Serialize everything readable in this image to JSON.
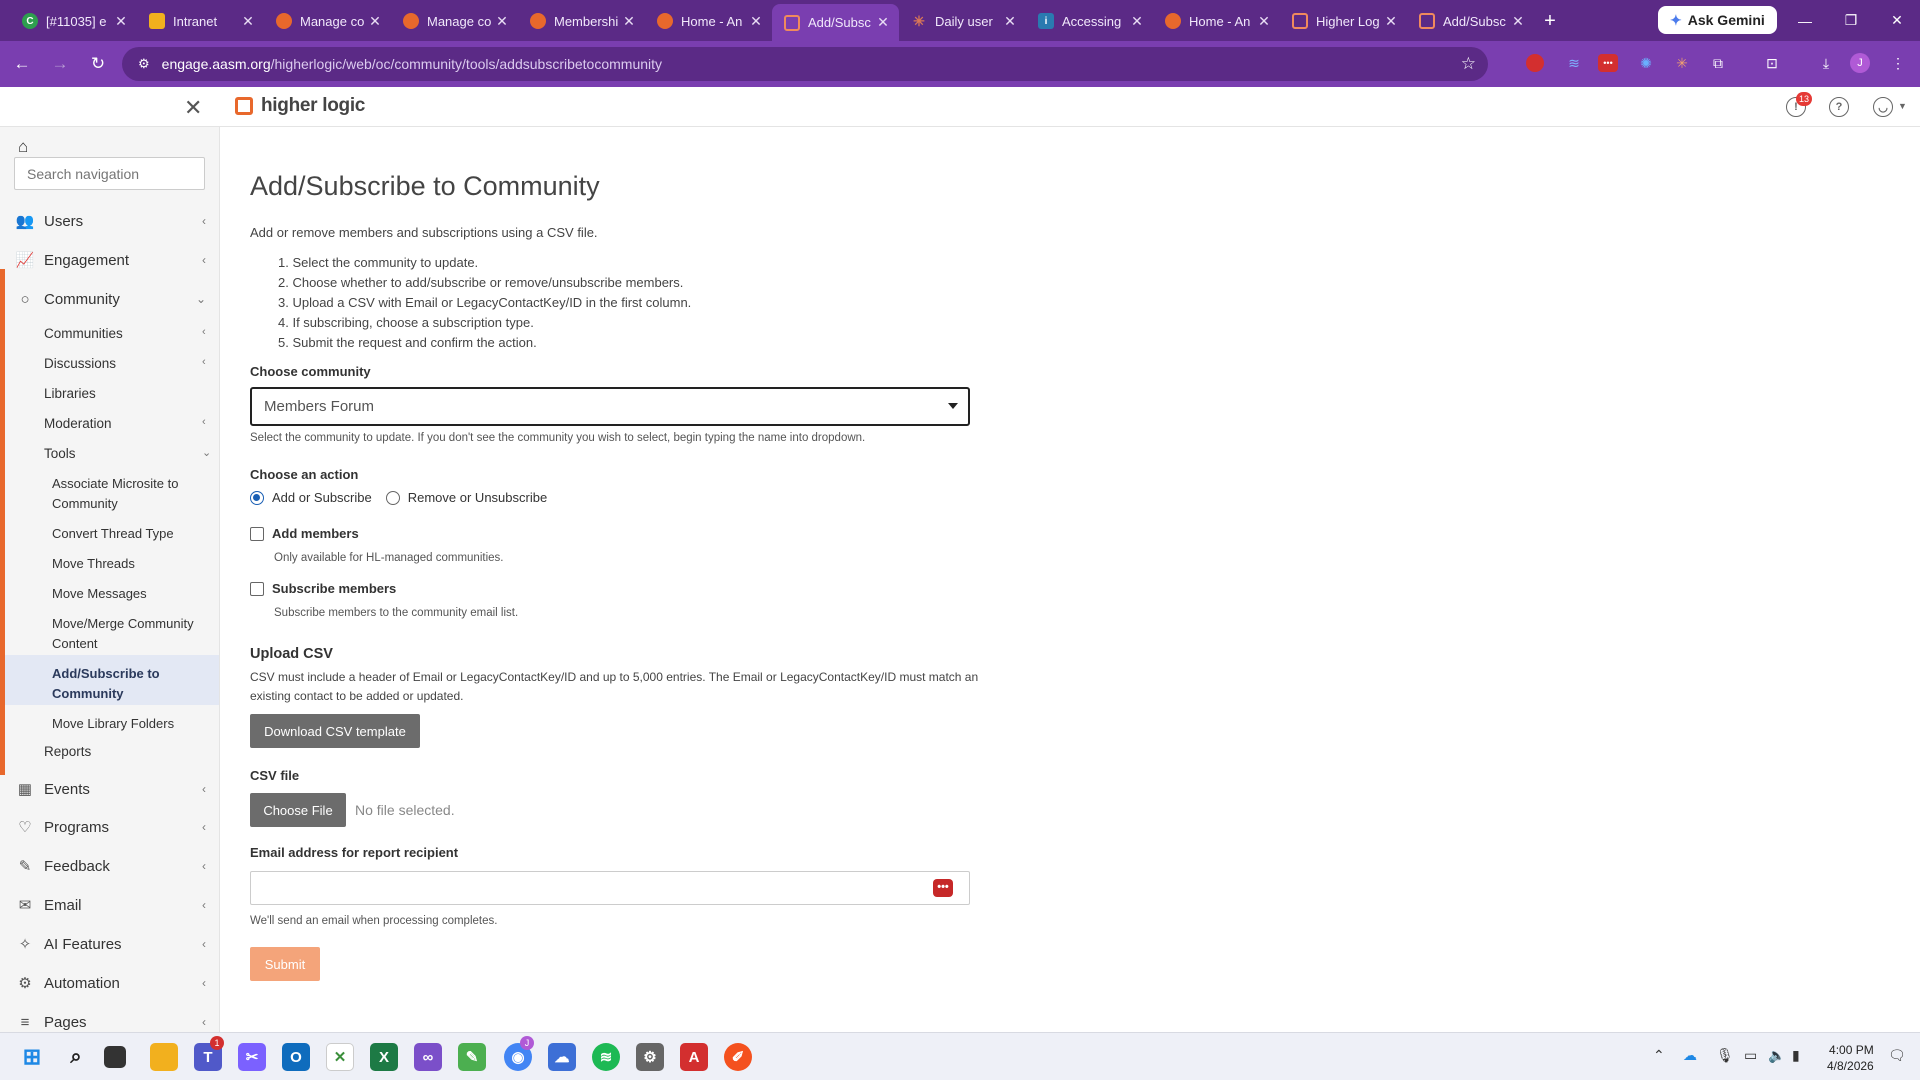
{
  "browser": {
    "tabs": [
      {
        "title": "[#11035] e",
        "icon": "green-circle-icon",
        "color": "#2e9e4f"
      },
      {
        "title": "Intranet",
        "icon": "yellow-doc-icon",
        "color": "#f2b01e"
      },
      {
        "title": "Manage co",
        "icon": "mini-logo-icon",
        "color": "#e8682c"
      },
      {
        "title": "Manage co",
        "icon": "mini-logo-icon",
        "color": "#e8682c"
      },
      {
        "title": "Membershi",
        "icon": "mini-logo-icon",
        "color": "#e8682c"
      },
      {
        "title": "Home - An",
        "icon": "mini-logo-icon",
        "color": "#e8682c"
      },
      {
        "title": "Add/Subsc",
        "icon": "higher-logic-icon",
        "color": "#e8682c",
        "active": true
      },
      {
        "title": "Daily user",
        "icon": "claude-icon",
        "color": "#d97757"
      },
      {
        "title": "Accessing",
        "icon": "info-icon",
        "color": "#2a7ab0"
      },
      {
        "title": "Home - An",
        "icon": "mini-logo-icon",
        "color": "#e8682c"
      },
      {
        "title": "Higher Log",
        "icon": "higher-logic-icon",
        "color": "#e8682c"
      },
      {
        "title": "Add/Subsc",
        "icon": "higher-logic-icon",
        "color": "#e8682c"
      }
    ],
    "ask_gemini": "Ask Gemini",
    "url_host": "engage.aasm.org",
    "url_path": "/higherlogic/web/oc/community/tools/addsubscribetocommunity"
  },
  "header": {
    "logo_text": "higher logic",
    "notification_count": "13"
  },
  "sidebar": {
    "search_placeholder": "Search navigation",
    "top_items": {
      "users": "Users",
      "engagement": "Engagement",
      "community": "Community",
      "events": "Events",
      "programs": "Programs",
      "feedback": "Feedback",
      "email": "Email",
      "ai": "AI Features",
      "automation": "Automation",
      "pages": "Pages"
    },
    "community_sub": {
      "communities": "Communities",
      "discussions": "Discussions",
      "libraries": "Libraries",
      "moderation": "Moderation",
      "tools": "Tools",
      "reports": "Reports"
    },
    "tools_items": {
      "associate": "Associate Microsite to Community",
      "convert": "Convert Thread Type",
      "move_threads": "Move Threads",
      "move_messages": "Move Messages",
      "merge": "Move/Merge Community Content",
      "add_subscribe": "Add/Subscribe to Community",
      "move_folders": "Move Library Folders"
    }
  },
  "main": {
    "title": "Add/Subscribe to Community",
    "description": "Add or remove members and subscriptions using a CSV file.",
    "steps": [
      "1. Select the community to update.",
      "2. Choose whether to add/subscribe or remove/unsubscribe members.",
      "3. Upload a CSV with Email or LegacyContactKey/ID in the first column.",
      "4. If subscribing, choose a subscription type.",
      "5. Submit the request and confirm the action."
    ],
    "choose_community_label": "Choose community",
    "community_value": "Members Forum",
    "community_help": "Select the community to update. If you don't see the community you wish to select, begin typing the name into dropdown.",
    "choose_action_label": "Choose an action",
    "action_add": "Add or Subscribe",
    "action_remove": "Remove or Unsubscribe",
    "add_members_label": "Add members",
    "add_members_help": "Only available for HL-managed communities.",
    "subscribe_members_label": "Subscribe members",
    "subscribe_members_help": "Subscribe members to the community email list.",
    "upload_heading": "Upload CSV",
    "upload_note": "CSV must include a header of Email or LegacyContactKey/ID and up to 5,000 entries. The Email or LegacyContactKey/ID must match an existing contact to be added or updated.",
    "download_template": "Download CSV template",
    "csv_file_label": "CSV file",
    "choose_file": "Choose File",
    "no_file": "No file selected.",
    "email_label": "Email address for report recipient",
    "email_value": "",
    "email_help": "We'll send an email when processing completes.",
    "submit": "Submit"
  },
  "taskbar": {
    "time": "4:00 PM",
    "date": "4/8/2026",
    "teams_badge": "1",
    "chrome_badge": "J"
  }
}
